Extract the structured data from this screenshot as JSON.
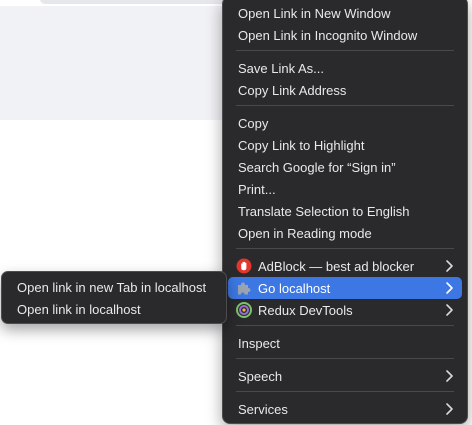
{
  "context_menu": {
    "groups": [
      [
        "Open Link in New Window",
        "Open Link in Incognito Window"
      ],
      [
        "Save Link As...",
        "Copy Link Address"
      ],
      [
        "Copy",
        "Copy Link to Highlight",
        "Search Google for “Sign in”",
        "Print...",
        "Translate Selection to English",
        "Open in Reading mode"
      ]
    ],
    "extensions": [
      {
        "label": "AdBlock — best ad blocker",
        "icon": "adblock-hand-icon",
        "has_submenu": true
      },
      {
        "label": "Go localhost",
        "icon": "puzzle-piece-icon",
        "has_submenu": true,
        "highlighted": true
      },
      {
        "label": "Redux DevTools",
        "icon": "redux-devtools-icon",
        "has_submenu": true
      }
    ],
    "inspect": "Inspect",
    "speech": "Speech",
    "services": "Services"
  },
  "submenu": {
    "items": [
      "Open link in new Tab in localhost",
      "Open link in localhost"
    ]
  },
  "colors": {
    "menu_bg": "#2a2a2c",
    "highlight": "#3c77e3",
    "text": "#e9e9ea",
    "separator": "#4a4a4d",
    "adblock_red": "#e0362b"
  }
}
